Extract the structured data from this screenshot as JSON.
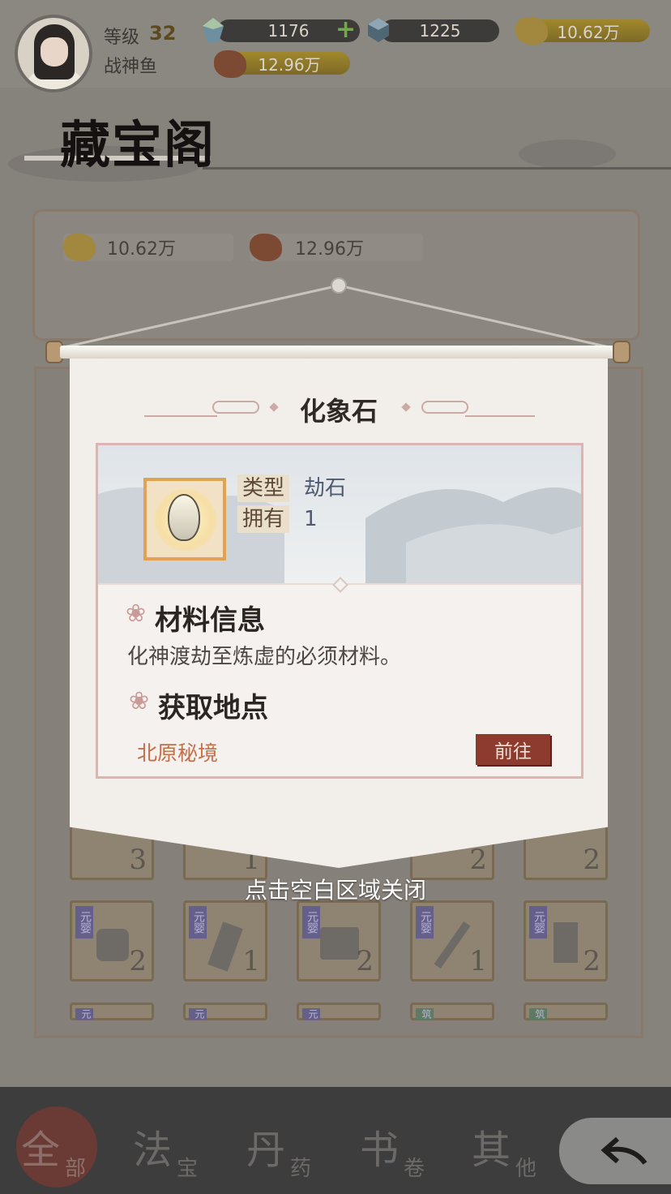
{
  "header": {
    "level_label": "等级",
    "level_value": "32",
    "player_name": "战神鱼",
    "currencies": [
      {
        "icon": "crystal-icon",
        "value": "1176",
        "add_icon": "+"
      },
      {
        "icon": "blue-gem-icon",
        "value": "1225"
      },
      {
        "icon": "gold-ore-icon",
        "value": "10.62万"
      },
      {
        "icon": "copper-ore-icon",
        "value": "12.96万"
      }
    ]
  },
  "page": {
    "title": "藏宝阁"
  },
  "resources": [
    {
      "icon": "gold-ore-icon",
      "value": "10.62万"
    },
    {
      "icon": "copper-ore-icon",
      "value": "12.96万"
    }
  ],
  "grid": {
    "row1_counts": [
      "3",
      "1",
      "2",
      "2"
    ],
    "row2": [
      {
        "tag": "元婴",
        "count": "2",
        "icon": "boots-icon"
      },
      {
        "tag": "元婴",
        "count": "1",
        "icon": "token-icon"
      },
      {
        "tag": "元婴",
        "count": "2",
        "icon": "cauldron-icon"
      },
      {
        "tag": "元婴",
        "count": "1",
        "icon": "whisk-icon"
      },
      {
        "tag": "元婴",
        "count": "2",
        "icon": "banner-icon"
      }
    ],
    "row3_tags": [
      "元",
      "元",
      "元",
      "筑",
      "筑"
    ]
  },
  "modal": {
    "title": "化象石",
    "item_icon": "stone-icon",
    "type_label": "类型",
    "type_value": "劫石",
    "owned_label": "拥有",
    "owned_value": "1",
    "info_heading": "材料信息",
    "info_text": "化神渡劫至炼虚的必须材料。",
    "source_heading": "获取地点",
    "source_location": "北原秘境",
    "go_button": "前往",
    "close_hint": "点击空白区域关闭"
  },
  "bottom_nav": {
    "tabs": [
      {
        "main": "全",
        "sub": "部",
        "active": true
      },
      {
        "main": "法",
        "sub": "宝"
      },
      {
        "main": "丹",
        "sub": "药"
      },
      {
        "main": "书",
        "sub": "卷"
      },
      {
        "main": "其",
        "sub": "他"
      }
    ],
    "back_icon": "back-arrow-icon"
  },
  "colors": {
    "accent_red": "#8d3b2e",
    "location_text": "#c26f4a",
    "frame_orange": "#e2a254",
    "card_border": "#d8b6b1"
  }
}
